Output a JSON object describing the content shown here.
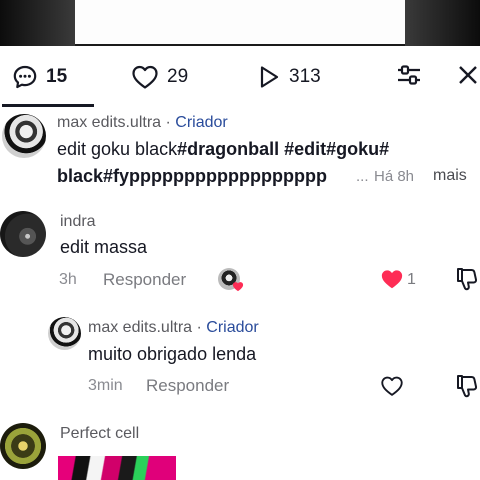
{
  "tabs": {
    "comments_count": "15",
    "likes_count": "29",
    "shares_count": "313"
  },
  "caption": {
    "username": "max edits.ultra",
    "separator": "·",
    "badge": "Criador",
    "line1_plain": "edit goku black",
    "line1_tags": "#dragonball #edit#goku#",
    "line2_tags": "black#fypppppppppppppppppp",
    "ellipsis": "...",
    "time": "Há 8h",
    "more": "mais"
  },
  "comments": [
    {
      "username": "indra",
      "text": "edit massa",
      "time": "3h",
      "reply": "Responder",
      "likes": "1",
      "liked": true,
      "creator_liked": true
    },
    {
      "username": "max edits.ultra",
      "separator": "·",
      "badge": "Criador",
      "text": "muito obrigado lenda",
      "time": "3min",
      "reply": "Responder"
    },
    {
      "username": "Perfect cell"
    }
  ],
  "colors": {
    "heart_red": "#fe2c55",
    "creator_blue": "#2a4c9b",
    "text": "#161823",
    "muted": "#8a8b91"
  }
}
